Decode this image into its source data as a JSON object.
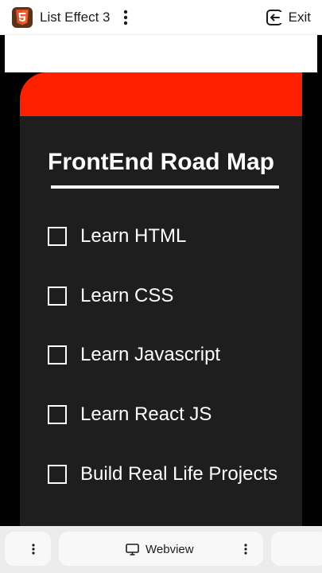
{
  "appbar": {
    "title": "List Effect 3",
    "exit_label": "Exit",
    "logo_icon": "html5-icon",
    "logo_color": "#5a3218",
    "logo_accent": "#e34f26"
  },
  "card": {
    "header_color": "#ff2000",
    "title": "FrontEnd Road Map",
    "tasks": [
      {
        "label": "Learn HTML",
        "checked": false
      },
      {
        "label": "Learn CSS",
        "checked": false
      },
      {
        "label": "Learn Javascript",
        "checked": false
      },
      {
        "label": "Learn React JS",
        "checked": false
      },
      {
        "label": "Build Real Life Projects",
        "checked": false
      }
    ]
  },
  "bottombar": {
    "webview_label": "Webview",
    "webview_icon": "monitor-icon"
  }
}
